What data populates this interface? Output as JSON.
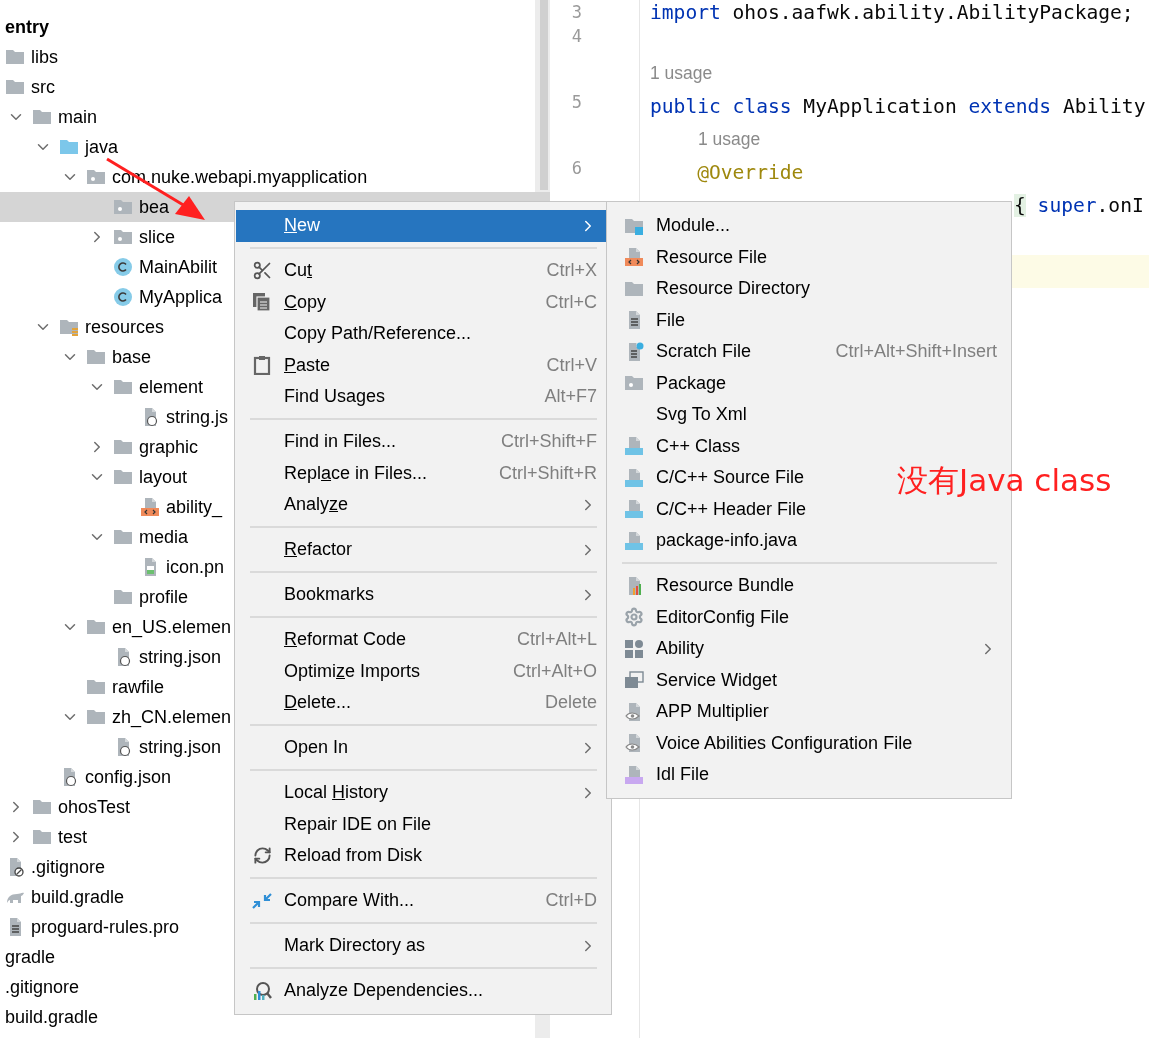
{
  "tree": [
    {
      "label": "entry",
      "kind": "module",
      "selected": false
    },
    {
      "label": "libs",
      "kind": "folder",
      "selected": false
    },
    {
      "label": "src",
      "kind": "folder",
      "selected": false,
      "children": [
        {
          "label": "main",
          "kind": "folder",
          "expanded": true,
          "selected": false,
          "children": [
            {
              "label": "java",
              "kind": "source-folder",
              "expanded": true,
              "selected": false,
              "children": [
                {
                  "label": "com.nuke.webapi.myapplication",
                  "kind": "package",
                  "expanded": true,
                  "selected": false,
                  "children": [
                    {
                      "label": "bea",
                      "kind": "package",
                      "selected": true
                    },
                    {
                      "label": "slice",
                      "kind": "package",
                      "expanded": false,
                      "selected": false
                    },
                    {
                      "label": "MainAbilit",
                      "kind": "class",
                      "selected": false
                    },
                    {
                      "label": "MyApplica",
                      "kind": "class",
                      "selected": false
                    }
                  ]
                }
              ]
            },
            {
              "label": "resources",
              "kind": "resource-folder",
              "expanded": true,
              "selected": false,
              "children": [
                {
                  "label": "base",
                  "kind": "folder",
                  "expanded": true,
                  "selected": false,
                  "children": [
                    {
                      "label": "element",
                      "kind": "folder",
                      "expanded": true,
                      "selected": false,
                      "children": [
                        {
                          "label": "string.js",
                          "kind": "json",
                          "selected": false
                        }
                      ]
                    },
                    {
                      "label": "graphic",
                      "kind": "folder",
                      "expanded": false,
                      "selected": false
                    },
                    {
                      "label": "layout",
                      "kind": "folder",
                      "expanded": true,
                      "selected": false,
                      "children": [
                        {
                          "label": "ability_",
                          "kind": "layout",
                          "selected": false
                        }
                      ]
                    },
                    {
                      "label": "media",
                      "kind": "folder",
                      "expanded": true,
                      "selected": false,
                      "children": [
                        {
                          "label": "icon.pn",
                          "kind": "image",
                          "selected": false
                        }
                      ]
                    },
                    {
                      "label": "profile",
                      "kind": "folder",
                      "selected": false
                    }
                  ]
                },
                {
                  "label": "en_US.elemen",
                  "kind": "folder",
                  "expanded": true,
                  "selected": false,
                  "children": [
                    {
                      "label": "string.json",
                      "kind": "json",
                      "selected": false
                    }
                  ]
                },
                {
                  "label": "rawfile",
                  "kind": "folder",
                  "selected": false
                },
                {
                  "label": "zh_CN.elemen",
                  "kind": "folder",
                  "expanded": true,
                  "selected": false,
                  "children": [
                    {
                      "label": "string.json",
                      "kind": "json",
                      "selected": false
                    }
                  ]
                }
              ]
            },
            {
              "label": "config.json",
              "kind": "json",
              "selected": false
            }
          ]
        },
        {
          "label": "ohosTest",
          "kind": "folder",
          "expanded": false,
          "selected": false
        },
        {
          "label": "test",
          "kind": "folder",
          "expanded": false,
          "selected": false
        }
      ]
    },
    {
      "label": ".gitignore",
      "kind": "ignore",
      "selected": false
    },
    {
      "label": "build.gradle",
      "kind": "gradle",
      "selected": false
    },
    {
      "label": "proguard-rules.pro",
      "kind": "text",
      "selected": false
    },
    {
      "label": "gradle",
      "kind": "plain",
      "selected": false
    },
    {
      "label": ".gitignore",
      "kind": "plain",
      "selected": false
    },
    {
      "label": "build.gradle",
      "kind": "plain",
      "selected": false
    }
  ],
  "editor": {
    "lines": [
      {
        "kind": "code",
        "number": "3",
        "current": false,
        "tokens": [
          {
            "kind": "keyword",
            "text": "import"
          },
          {
            "kind": "plain",
            "text": " ohos.aafwk.ability.AbilityPackage;"
          }
        ]
      },
      {
        "kind": "code",
        "number": "4",
        "current": false
      },
      {
        "kind": "inlay",
        "text": "1 usage",
        "nested": false
      },
      {
        "kind": "code",
        "number": "5",
        "current": false,
        "tokens": [
          {
            "kind": "keyword",
            "text": "public class"
          },
          {
            "kind": "plain",
            "text": " MyApplication "
          },
          {
            "kind": "keyword",
            "text": "extends"
          },
          {
            "kind": "plain",
            "text": " Ability"
          }
        ]
      },
      {
        "kind": "inlay",
        "text": "1 usage",
        "nested": true
      },
      {
        "kind": "code",
        "number": "6",
        "current": false,
        "tokens": [
          {
            "kind": "annotation",
            "text": "    @Override"
          }
        ]
      },
      {
        "kind": "code",
        "covered": true,
        "current": false,
        "tokens": [
          {
            "kind": "brace",
            "text": "{"
          },
          {
            "kind": "keyword",
            "text": " super"
          },
          {
            "kind": "plain",
            "text": ".onI"
          }
        ]
      },
      {
        "kind": "code",
        "current": false
      },
      {
        "kind": "code",
        "current": true
      }
    ]
  },
  "context_menu": {
    "items": [
      {
        "kind": "action",
        "label": [
          {
            "text": "N",
            "underline": true
          },
          {
            "text": "ew",
            "underline": false
          }
        ],
        "submenu": true,
        "selected": true
      },
      {
        "kind": "separator"
      },
      {
        "kind": "cut",
        "label": [
          {
            "text": "Cu",
            "underline": false
          },
          {
            "text": "t",
            "underline": true
          }
        ],
        "shortcut": "Ctrl+X",
        "selected": false
      },
      {
        "kind": "copy",
        "label": [
          {
            "text": "C",
            "underline": true
          },
          {
            "text": "opy",
            "underline": false
          }
        ],
        "shortcut": "Ctrl+C",
        "selected": false
      },
      {
        "kind": "action",
        "label": "Copy Path/Reference...",
        "selected": false
      },
      {
        "kind": "paste",
        "label": [
          {
            "text": "P",
            "underline": true
          },
          {
            "text": "aste",
            "underline": false
          }
        ],
        "shortcut": "Ctrl+V",
        "selected": false
      },
      {
        "kind": "action",
        "label": "Find Usages",
        "shortcut": "Alt+F7",
        "selected": false
      },
      {
        "kind": "separator"
      },
      {
        "kind": "action",
        "label": "Find in Files...",
        "shortcut": "Ctrl+Shift+F",
        "selected": false
      },
      {
        "kind": "action",
        "label": [
          {
            "text": "Repl",
            "underline": false
          },
          {
            "text": "a",
            "underline": true
          },
          {
            "text": "ce in Files...",
            "underline": false
          }
        ],
        "shortcut": "Ctrl+Shift+R",
        "selected": false
      },
      {
        "kind": "action",
        "label": [
          {
            "text": "Analy",
            "underline": false
          },
          {
            "text": "z",
            "underline": true
          },
          {
            "text": "e",
            "underline": false
          }
        ],
        "submenu": true,
        "selected": false
      },
      {
        "kind": "separator"
      },
      {
        "kind": "action",
        "label": [
          {
            "text": "R",
            "underline": true
          },
          {
            "text": "efactor",
            "underline": false
          }
        ],
        "submenu": true,
        "selected": false
      },
      {
        "kind": "separator"
      },
      {
        "kind": "action",
        "label": "Bookmarks",
        "submenu": true,
        "selected": false
      },
      {
        "kind": "separator"
      },
      {
        "kind": "action",
        "label": [
          {
            "text": "R",
            "underline": true
          },
          {
            "text": "eformat Code",
            "underline": false
          }
        ],
        "shortcut": "Ctrl+Alt+L",
        "selected": false
      },
      {
        "kind": "action",
        "label": [
          {
            "text": "Optimi",
            "underline": false
          },
          {
            "text": "z",
            "underline": true
          },
          {
            "text": "e Imports",
            "underline": false
          }
        ],
        "shortcut": "Ctrl+Alt+O",
        "selected": false
      },
      {
        "kind": "action",
        "label": [
          {
            "text": "D",
            "underline": true
          },
          {
            "text": "elete...",
            "underline": false
          }
        ],
        "shortcut": "Delete",
        "selected": false
      },
      {
        "kind": "separator"
      },
      {
        "kind": "action",
        "label": "Open In",
        "submenu": true,
        "selected": false
      },
      {
        "kind": "separator"
      },
      {
        "kind": "action",
        "label": [
          {
            "text": "Local ",
            "underline": false
          },
          {
            "text": "H",
            "underline": true
          },
          {
            "text": "istory",
            "underline": false
          }
        ],
        "submenu": true,
        "selected": false
      },
      {
        "kind": "action",
        "label": "Repair IDE on File",
        "selected": false
      },
      {
        "kind": "reload",
        "label": "Reload from Disk",
        "selected": false
      },
      {
        "kind": "separator"
      },
      {
        "kind": "compare",
        "label": "Compare With...",
        "shortcut": "Ctrl+D",
        "selected": false
      },
      {
        "kind": "separator"
      },
      {
        "kind": "action",
        "label": "Mark Directory as",
        "submenu": true,
        "selected": false
      },
      {
        "kind": "separator"
      },
      {
        "kind": "analyze",
        "label": "Analyze Dependencies...",
        "selected": false
      }
    ]
  },
  "new_submenu": {
    "items": [
      {
        "kind": "new-module",
        "label": "Module...",
        "selected": false
      },
      {
        "kind": "resource-file",
        "label": "Resource File",
        "selected": false
      },
      {
        "kind": "folder",
        "label": "Resource Directory",
        "selected": false
      },
      {
        "kind": "file",
        "label": "File",
        "selected": false
      },
      {
        "kind": "scratch",
        "label": "Scratch File",
        "shortcut": "Ctrl+Alt+Shift+Insert",
        "selected": false
      },
      {
        "kind": "package",
        "label": "Package",
        "selected": false
      },
      {
        "kind": "action",
        "label": "Svg To Xml",
        "selected": false
      },
      {
        "kind": "cpp",
        "label": "C++ Class",
        "selected": false
      },
      {
        "kind": "c",
        "label": "C/C++ Source File",
        "selected": false
      },
      {
        "kind": "h",
        "label": "C/C++ Header File",
        "selected": false
      },
      {
        "kind": "java",
        "label": "package-info.java",
        "selected": false
      },
      {
        "kind": "separator"
      },
      {
        "kind": "bundle",
        "label": "Resource Bundle",
        "selected": false
      },
      {
        "kind": "gear",
        "label": "EditorConfig File",
        "selected": false
      },
      {
        "kind": "ability",
        "label": "Ability",
        "submenu": true,
        "selected": false
      },
      {
        "kind": "widget",
        "label": "Service Widget",
        "selected": false
      },
      {
        "kind": "eye",
        "label": "APP Multiplier",
        "selected": false
      },
      {
        "kind": "eye",
        "label": "Voice Abilities Configuration File",
        "selected": false
      },
      {
        "kind": "idl",
        "label": "Idl File",
        "selected": false
      }
    ]
  },
  "annotation": {
    "text": "没有Java class"
  }
}
